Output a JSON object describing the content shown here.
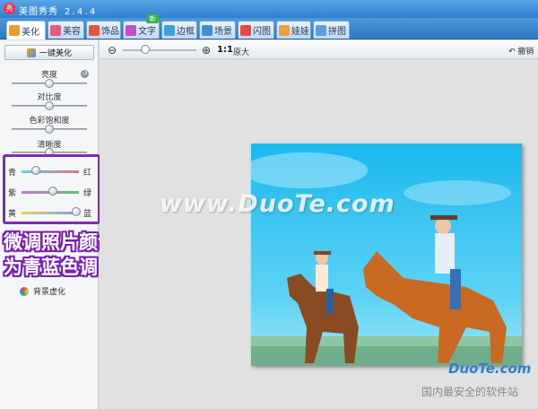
{
  "window": {
    "title": "美图秀秀 2.4.4"
  },
  "tabs": [
    {
      "label": "美化",
      "icon": "beautify-icon",
      "active": true
    },
    {
      "label": "美容",
      "icon": "makeup-icon"
    },
    {
      "label": "饰品",
      "icon": "heart-icon"
    },
    {
      "label": "文字",
      "icon": "text-icon",
      "badge": "新"
    },
    {
      "label": "边框",
      "icon": "frame-icon"
    },
    {
      "label": "场景",
      "icon": "scene-icon"
    },
    {
      "label": "闪图",
      "icon": "flash-icon"
    },
    {
      "label": "娃娃",
      "icon": "doll-icon"
    },
    {
      "label": "拼图",
      "icon": "puzzle-icon"
    }
  ],
  "left_panel": {
    "one_click": "一键美化",
    "adjustments": [
      {
        "label": "亮度",
        "value": 0.5
      },
      {
        "label": "对比度",
        "value": 0.5
      },
      {
        "label": "色彩饱和度",
        "value": 0.5
      },
      {
        "label": "清晰度",
        "value": 0.5
      }
    ],
    "color_balance": [
      {
        "left": "青",
        "right": "红",
        "value": 0.25
      },
      {
        "left": "紫",
        "right": "绿",
        "value": 0.55
      },
      {
        "left": "黄",
        "right": "蓝",
        "value": 0.95
      }
    ],
    "background_blur": "背景虚化",
    "colors": {
      "highlight_border": "#7d2bb0"
    }
  },
  "annotation": {
    "line1": "微调照片颜色",
    "line2": "为青蓝色调"
  },
  "toolbar": {
    "zoom_ratio": "1:1",
    "original_label": "原大",
    "undo_label": "撤销",
    "zoom_value": 0.3
  },
  "watermarks": {
    "center": "www.DuoTe.com",
    "logo": "DuoTe.com",
    "slogan": "国内最安全的软件站"
  }
}
